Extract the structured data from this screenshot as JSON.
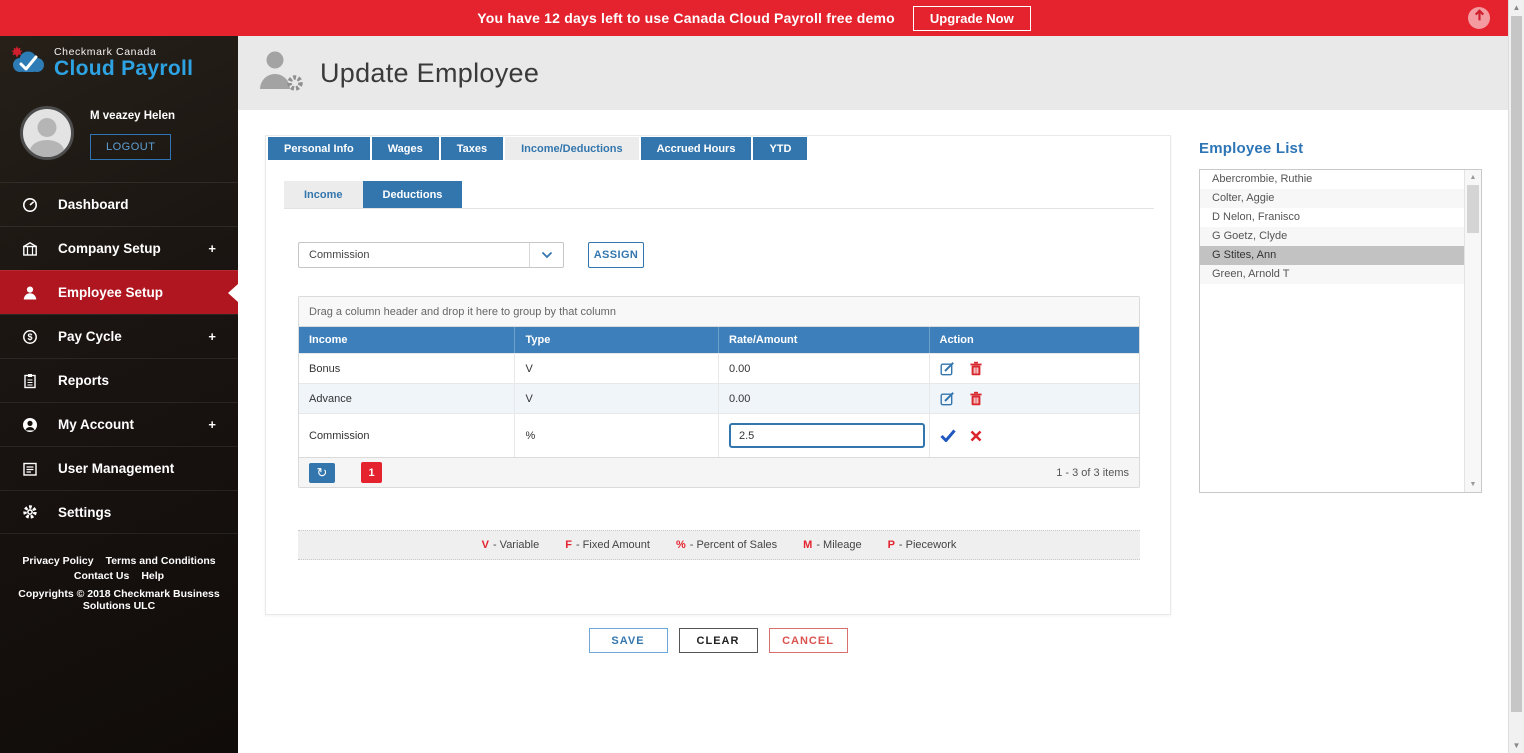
{
  "banner": {
    "message": "You have 12 days left to use Canada Cloud Payroll free demo",
    "upgrade_label": "Upgrade Now"
  },
  "logo": {
    "line1": "Checkmark Canada",
    "line2": "Cloud Payroll"
  },
  "user": {
    "name": "M veazey Helen",
    "logout_label": "LOGOUT"
  },
  "sidebar": {
    "items": [
      {
        "label": "Dashboard"
      },
      {
        "label": "Company Setup",
        "plus": "+"
      },
      {
        "label": "Employee Setup"
      },
      {
        "label": "Pay Cycle",
        "plus": "+"
      },
      {
        "label": "Reports"
      },
      {
        "label": "My Account",
        "plus": "+"
      },
      {
        "label": "User Management"
      },
      {
        "label": "Settings"
      }
    ],
    "active_item": "Employee Setup"
  },
  "footer": {
    "links": [
      "Privacy Policy",
      "Terms and Conditions",
      "Contact Us",
      "Help"
    ],
    "copyright": "Copyrights © 2018 Checkmark Business Solutions ULC"
  },
  "header": {
    "title": "Update Employee"
  },
  "tabs": {
    "items": [
      "Personal Info",
      "Wages",
      "Taxes",
      "Income/Deductions",
      "Accrued Hours",
      "YTD"
    ],
    "active": "Income/Deductions"
  },
  "subtabs": {
    "items": [
      "Income",
      "Deductions"
    ],
    "active": "Deductions"
  },
  "assign": {
    "selected": "Commission",
    "button_label": "ASSIGN"
  },
  "grid": {
    "group_hint": "Drag a column header and drop it here to group by that column",
    "columns": [
      "Income",
      "Type",
      "Rate/Amount",
      "Action"
    ],
    "rows": [
      {
        "income": "Bonus",
        "type": "V",
        "rate": "0.00"
      },
      {
        "income": "Advance",
        "type": "V",
        "rate": "0.00"
      },
      {
        "income": "Commission",
        "type": "%",
        "rate": "2.5"
      }
    ],
    "pager": {
      "page": "1",
      "info": "1 - 3 of 3 items"
    }
  },
  "legend": {
    "items": [
      {
        "key": "V",
        "rest": "- Variable"
      },
      {
        "key": "F",
        "rest": "- Fixed Amount"
      },
      {
        "key": "%",
        "rest": "- Percent of Sales"
      },
      {
        "key": "M",
        "rest": "- Mileage"
      },
      {
        "key": "P",
        "rest": "- Piecework"
      }
    ]
  },
  "buttons": {
    "save": "SAVE",
    "clear": "CLEAR",
    "cancel": "CANCEL"
  },
  "employee_list": {
    "title": "Employee List",
    "items": [
      "Abercrombie, Ruthie",
      "Colter, Aggie",
      "D Nelon, Franisco",
      "G Goetz, Clyde",
      "G Stites, Ann",
      "Green, Arnold T"
    ],
    "selected": "G Stites, Ann",
    "selected_index": 4
  },
  "icons": {
    "refresh": "↻",
    "scroll_up": "▲",
    "scroll_down": "▼"
  },
  "colors": {
    "banner_red": "#e4232e",
    "sidebar_active_red": "#b0161f",
    "accent_blue": "#3376ae",
    "grid_header_blue": "#3d7fba",
    "logo_blue": "#2ea3e3",
    "list_title_blue": "#2e75b6",
    "delete_red": "#d9272e"
  }
}
